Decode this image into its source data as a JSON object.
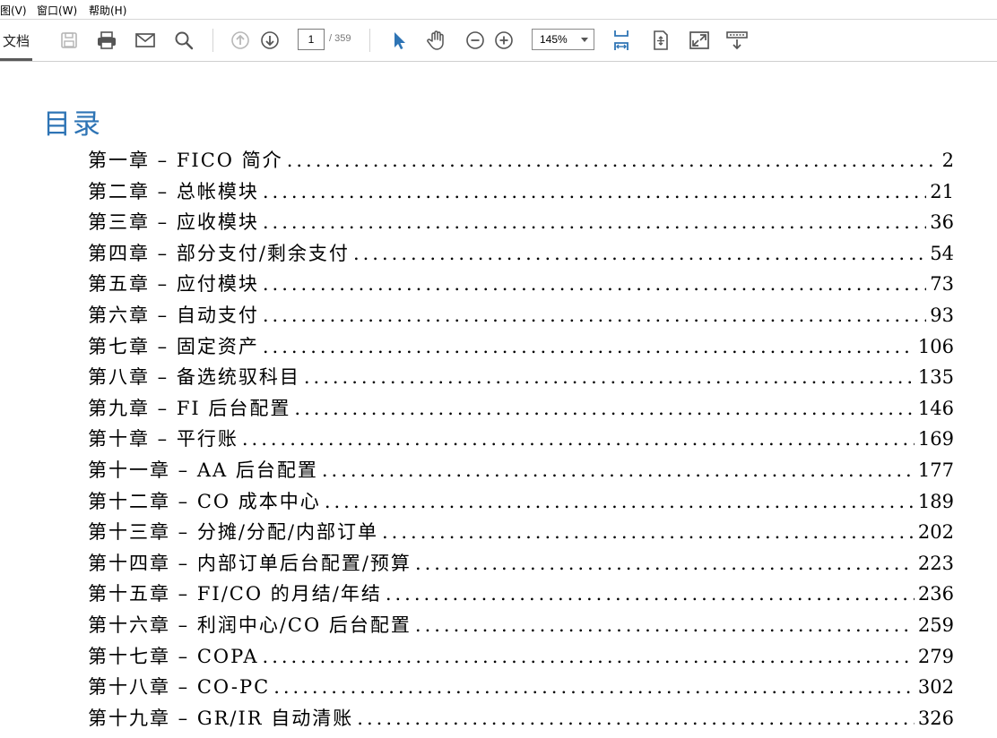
{
  "menu": {
    "view": "图(V)",
    "window": "窗口(W)",
    "help": "帮助(H)"
  },
  "toolbar": {
    "tab_label": "文档",
    "page_current": "1",
    "page_total": "/ 359",
    "zoom": "145%",
    "icons": [
      "save-icon",
      "print-icon",
      "email-icon",
      "search-icon",
      "previous-page-icon",
      "next-page-icon",
      "select-cursor-icon",
      "hand-tool-icon",
      "zoom-out-icon",
      "zoom-in-icon",
      "fit-width-icon",
      "fit-page-icon",
      "full-screen-icon",
      "read-mode-icon"
    ],
    "accent_color": "#2e74b5"
  },
  "document": {
    "heading": "目录",
    "entries": [
      {
        "title": "第一章 – FICO 简介",
        "page": "2"
      },
      {
        "title": "第二章 – 总帐模块",
        "page": "21"
      },
      {
        "title": "第三章 – 应收模块",
        "page": "36"
      },
      {
        "title": "第四章 – 部分支付/剩余支付",
        "page": "54"
      },
      {
        "title": "第五章 – 应付模块",
        "page": "73"
      },
      {
        "title": "第六章 – 自动支付",
        "page": "93"
      },
      {
        "title": "第七章 – 固定资产",
        "page": "106"
      },
      {
        "title": "第八章 – 备选统驭科目",
        "page": "135"
      },
      {
        "title": "第九章 – FI 后台配置",
        "page": "146"
      },
      {
        "title": "第十章 – 平行账",
        "page": "169"
      },
      {
        "title": "第十一章 – AA 后台配置",
        "page": "177"
      },
      {
        "title": "第十二章 – CO 成本中心",
        "page": "189"
      },
      {
        "title": "第十三章 – 分摊/分配/内部订单",
        "page": "202"
      },
      {
        "title": "第十四章 – 内部订单后台配置/预算",
        "page": "223"
      },
      {
        "title": "第十五章 – FI/CO 的月结/年结",
        "page": "236"
      },
      {
        "title": "第十六章 – 利润中心/CO 后台配置",
        "page": "259"
      },
      {
        "title": "第十七章 – COPA",
        "page": "279"
      },
      {
        "title": "第十八章 – CO-PC",
        "page": "302"
      },
      {
        "title": "第十九章 – GR/IR 自动清账",
        "page": "326"
      }
    ]
  }
}
